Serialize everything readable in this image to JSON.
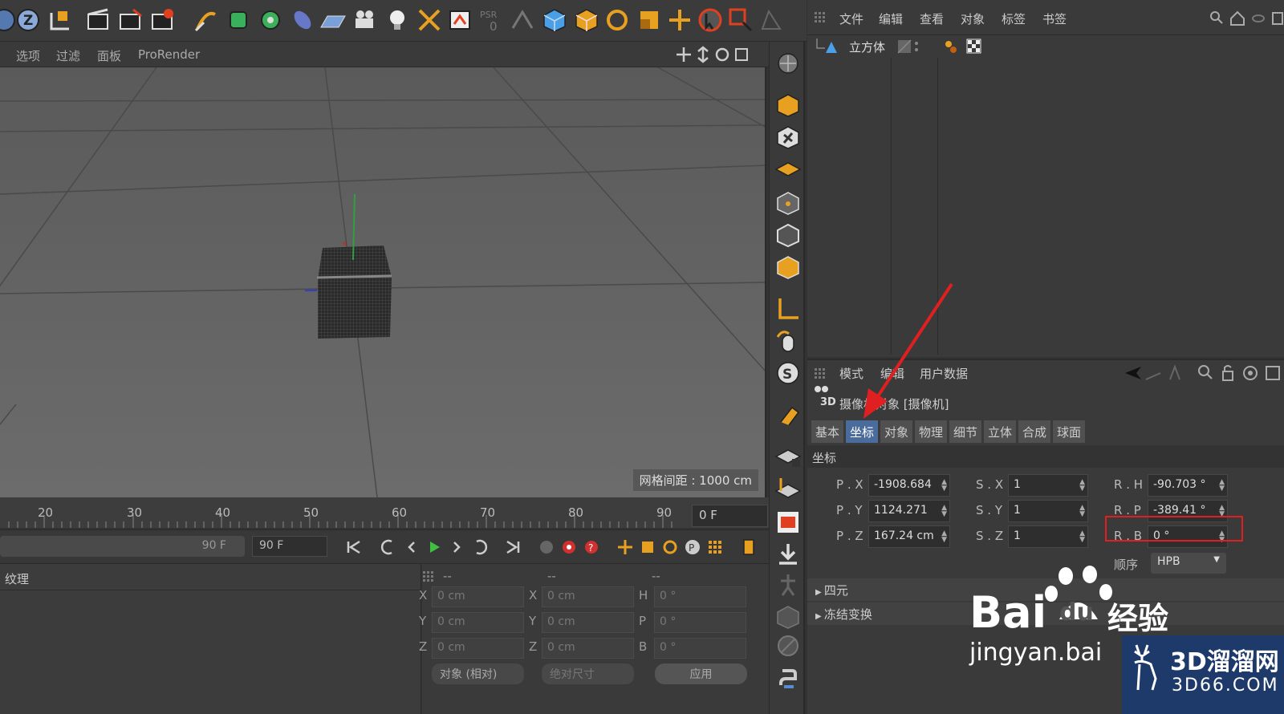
{
  "colors": {
    "accent_blue": "#4a6c9c",
    "highlight_red": "#e02020",
    "arrow_red": "#e02020",
    "orange_icon": "#e8a020",
    "panel_bg": "#3a3a3a",
    "viewport_bg": "#636363"
  },
  "viewport": {
    "menu": [
      "选项",
      "过滤",
      "面板",
      "ProRender"
    ],
    "grid_info": "网格间距 : 1000 cm"
  },
  "timeline": {
    "ticks": [
      "20",
      "30",
      "40",
      "50",
      "60",
      "70",
      "80",
      "90"
    ],
    "current_frame": "0 F",
    "end_frame_slider": "90 F",
    "end_frame_field": "90 F"
  },
  "material_panel": {
    "title": "纹理"
  },
  "coord_manager": {
    "headers": [
      "--",
      "--",
      "--"
    ],
    "rows": [
      {
        "l1": "X",
        "v1": "0 cm",
        "l2": "X",
        "v2": "0 cm",
        "l3": "H",
        "v3": "0 °"
      },
      {
        "l1": "Y",
        "v1": "0 cm",
        "l2": "Y",
        "v2": "0 cm",
        "l3": "P",
        "v3": "0 °"
      },
      {
        "l1": "Z",
        "v1": "0 cm",
        "l2": "Z",
        "v2": "0 cm",
        "l3": "B",
        "v3": "0 °"
      }
    ],
    "mode_select": "对象 (相对)",
    "size_select": "绝对尺寸",
    "apply_button": "应用"
  },
  "object_manager": {
    "menu": [
      "文件",
      "编辑",
      "查看",
      "对象",
      "标签",
      "书签"
    ],
    "object_name": "立方体"
  },
  "attribute_manager": {
    "menu": [
      "模式",
      "编辑",
      "用户数据"
    ],
    "object_title": "摄像机对象 [摄像机]",
    "tabs": [
      "基本",
      "坐标",
      "对象",
      "物理",
      "细节",
      "立体",
      "合成",
      "球面"
    ],
    "active_tab": "坐标",
    "section": "坐标",
    "fields": {
      "px_label": "P . X",
      "px": "-1908.684",
      "py_label": "P . Y",
      "py": "1124.271",
      "pz_label": "P . Z",
      "pz": "167.24 cm",
      "sx_label": "S . X",
      "sx": "1",
      "sy_label": "S . Y",
      "sy": "1",
      "sz_label": "S . Z",
      "sz": "1",
      "rh_label": "R . H",
      "rh": "-90.703 °",
      "rp_label": "R . P",
      "rp": "-389.41 °",
      "rb_label": "R . B",
      "rb": "0 °"
    },
    "order_label": "顺序",
    "order_value": "HPB",
    "collapse": [
      "四元",
      "冻结变换"
    ]
  },
  "watermark": {
    "baidu_text": "Bai",
    "baidu_du": "du",
    "baidu_jingyan": "经验",
    "baidu_url": "jingyan.bai",
    "brand_cn": "3D溜溜网",
    "brand_url": "3D66.COM"
  }
}
